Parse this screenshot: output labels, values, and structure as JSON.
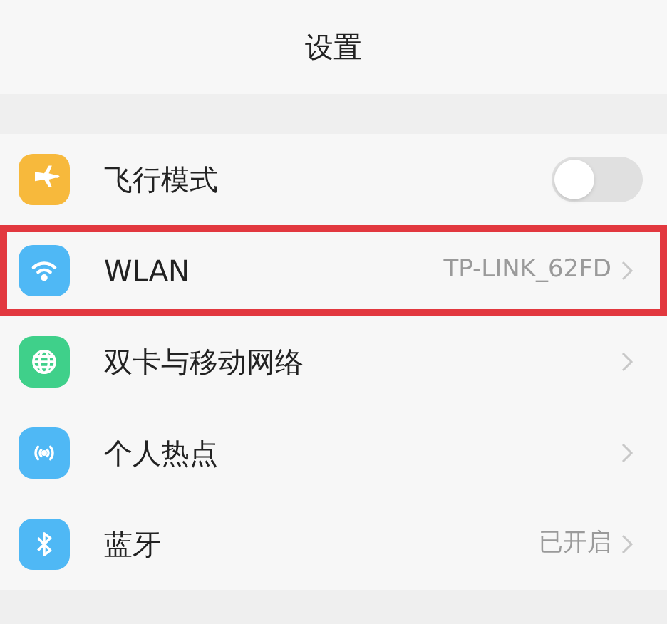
{
  "header": {
    "title": "设置"
  },
  "rows": [
    {
      "kind": "toggle",
      "label": "飞行模式",
      "on": false,
      "highlighted": false
    },
    {
      "kind": "link",
      "label": "WLAN",
      "value": "TP-LINK_62FD",
      "highlighted": true
    },
    {
      "kind": "link",
      "label": "双卡与移动网络",
      "highlighted": false
    },
    {
      "kind": "link",
      "label": "个人热点",
      "highlighted": false
    },
    {
      "kind": "link",
      "label": "蓝牙",
      "value": "已开启",
      "highlighted": false
    }
  ]
}
